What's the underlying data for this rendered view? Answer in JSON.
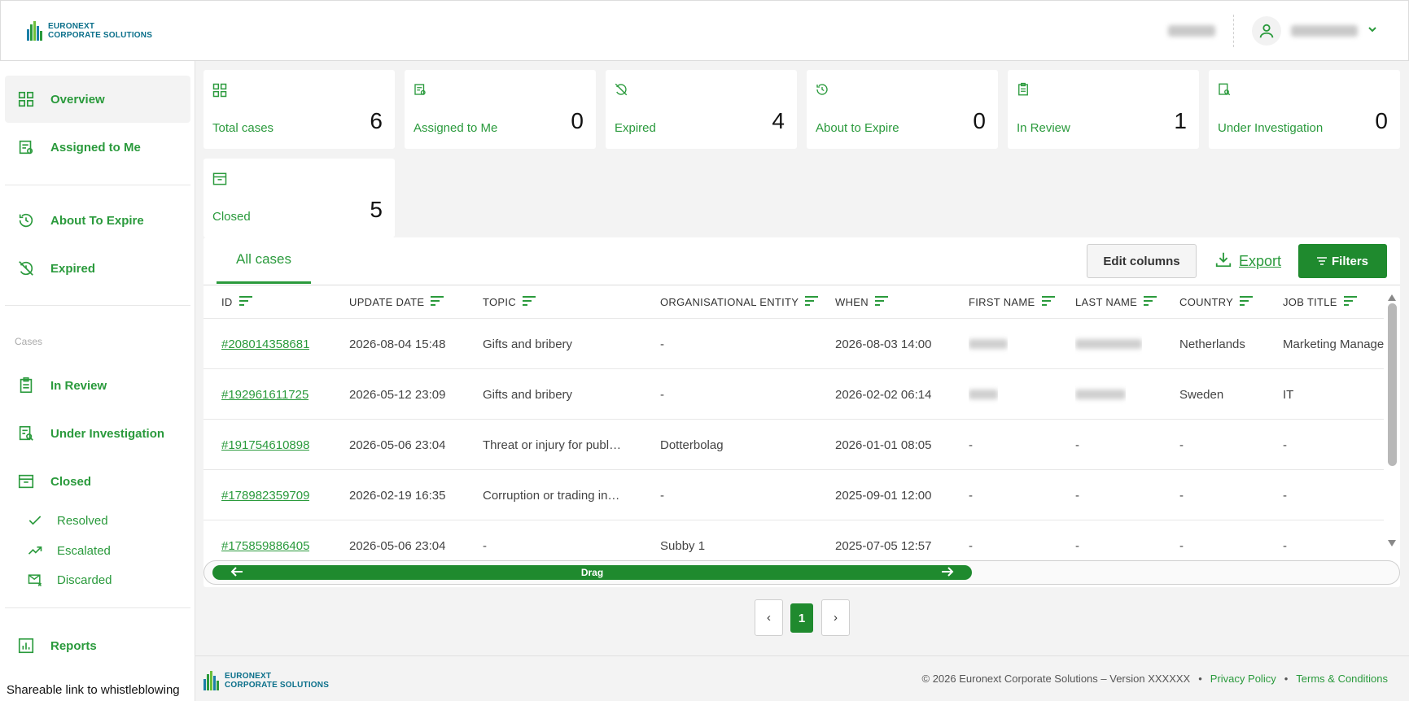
{
  "brand": {
    "line1": "EURONEXT",
    "line2": "CORPORATE SOLUTIONS"
  },
  "header": {
    "org_name_blurred": "",
    "user_name_blurred": ""
  },
  "sidebar": {
    "items": [
      {
        "label": "Overview"
      },
      {
        "label": "Assigned to Me"
      },
      {
        "label": "About To Expire"
      },
      {
        "label": "Expired"
      },
      {
        "label": "In Review"
      },
      {
        "label": "Under Investigation"
      },
      {
        "label": "Closed"
      },
      {
        "label": "Reports"
      }
    ],
    "section_cases": "Cases",
    "subitems": [
      {
        "label": "Resolved"
      },
      {
        "label": "Escalated"
      },
      {
        "label": "Discarded"
      }
    ],
    "share_link": "Shareable link to whistleblowing"
  },
  "stats": [
    {
      "label": "Total cases",
      "value": "6"
    },
    {
      "label": "Assigned to Me",
      "value": "0"
    },
    {
      "label": "Expired",
      "value": "4"
    },
    {
      "label": "About to Expire",
      "value": "0"
    },
    {
      "label": "In Review",
      "value": "1"
    },
    {
      "label": "Under Investigation",
      "value": "0"
    },
    {
      "label": "Closed",
      "value": "5"
    }
  ],
  "table": {
    "tab": "All cases",
    "edit_columns": "Edit columns",
    "export": "Export",
    "filters": "Filters",
    "columns": [
      "ID",
      "UPDATE DATE",
      "TOPIC",
      "ORGANISATIONAL ENTITY",
      "WHEN",
      "FIRST NAME",
      "LAST NAME",
      "COUNTRY",
      "JOB TITLE"
    ],
    "rows": [
      {
        "id": "#208014358681",
        "update": "2026-08-04 15:48",
        "topic": "Gifts and bribery",
        "entity": "-",
        "when": "2026-08-03 14:00",
        "first": "",
        "last": "",
        "country": "Netherlands",
        "job": "Marketing Manager"
      },
      {
        "id": "#192961611725",
        "update": "2026-05-12 23:09",
        "topic": "Gifts and bribery",
        "entity": "-",
        "when": "2026-02-02 06:14",
        "first": "",
        "last": "",
        "country": "Sweden",
        "job": "IT"
      },
      {
        "id": "#191754610898",
        "update": "2026-05-06 23:04",
        "topic": "Threat or injury for publ…",
        "entity": "Dotterbolag",
        "when": "2026-01-01 08:05",
        "first": "-",
        "last": "-",
        "country": "-",
        "job": "-"
      },
      {
        "id": "#178982359709",
        "update": "2026-02-19 16:35",
        "topic": "Corruption or trading in…",
        "entity": "-",
        "when": "2025-09-01 12:00",
        "first": "-",
        "last": "-",
        "country": "-",
        "job": "-"
      },
      {
        "id": "#175859886405",
        "update": "2026-05-06 23:04",
        "topic": "-",
        "entity": "Subby 1",
        "when": "2025-07-05 12:57",
        "first": "-",
        "last": "-",
        "country": "-",
        "job": "-"
      }
    ],
    "drag_label": "Drag"
  },
  "pagination": {
    "prev": "‹",
    "current": "1",
    "next": "›"
  },
  "footer": {
    "copyright": "© 2026 Euronext Corporate Solutions – Version XXXXXX",
    "sep": "•",
    "privacy": "Privacy Policy",
    "terms": "Terms & Conditions"
  },
  "colors": {
    "accent": "#2a9a3c",
    "button": "#1f8a2e",
    "logo_text": "#0a6f8a"
  }
}
